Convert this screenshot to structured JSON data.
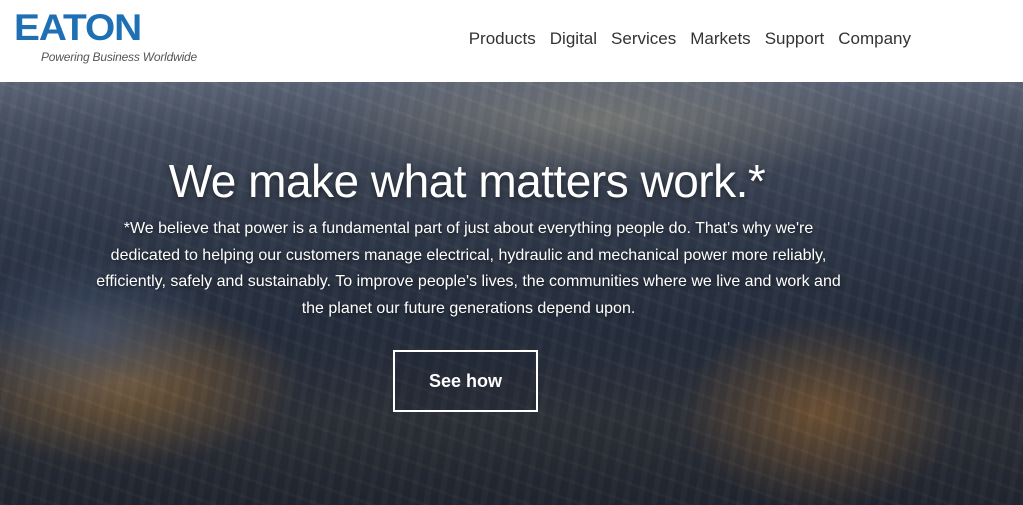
{
  "header": {
    "logo_word": "EATON",
    "logo_tagline": "Powering Business Worldwide",
    "nav": [
      {
        "label": "Products"
      },
      {
        "label": "Digital"
      },
      {
        "label": "Services"
      },
      {
        "label": "Markets"
      },
      {
        "label": "Support"
      },
      {
        "label": "Company"
      }
    ]
  },
  "hero": {
    "title": "We make what matters work.*",
    "text": "*We believe that power is a fundamental part of just about everything people do. That's why we're dedicated to helping our customers manage electrical, hydraulic and mechanical power more reliably, efficiently, safely and sustainably. To improve people's lives, the communities where we live and work and the planet our future generations depend upon.",
    "button_label": "See how"
  },
  "colors": {
    "brand_blue": "#1f6fb4",
    "nav_text": "#333333",
    "hero_text": "#ffffff"
  }
}
